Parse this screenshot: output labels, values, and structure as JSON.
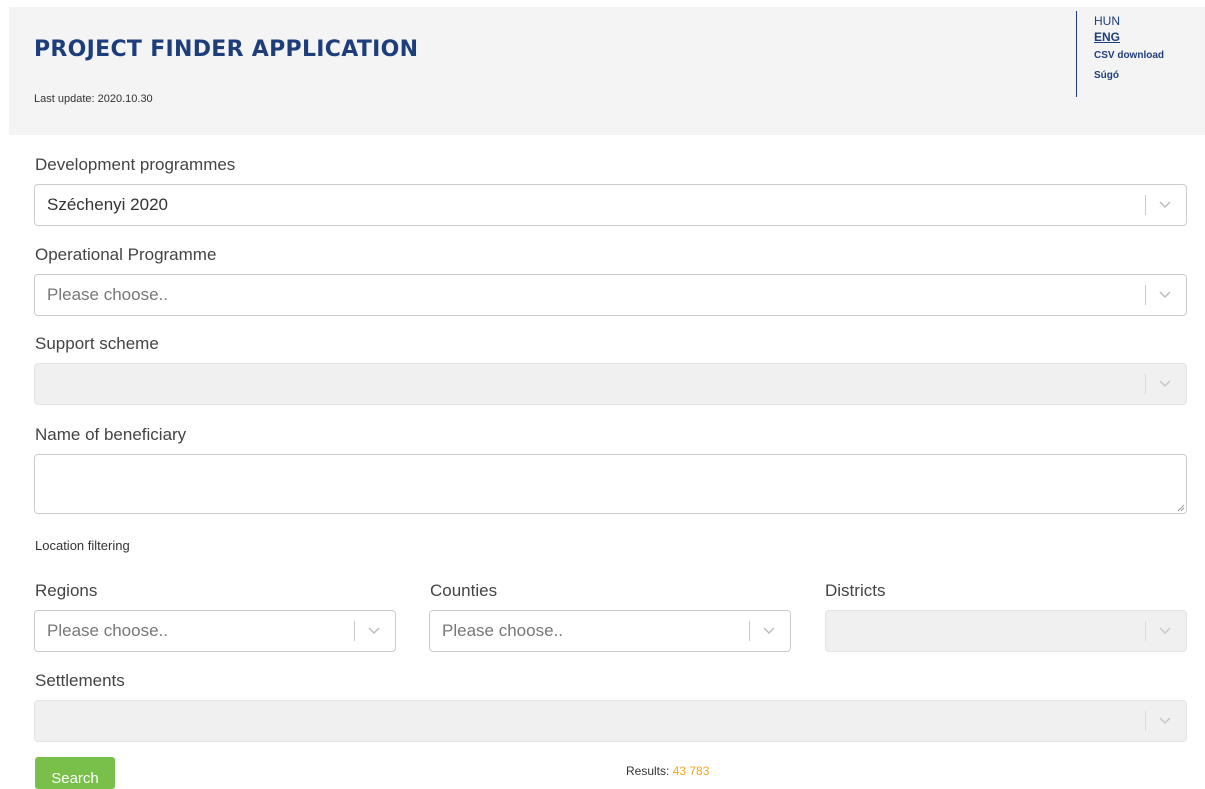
{
  "header": {
    "title": "PROJECT FINDER APPLICATION",
    "last_update_label": "Last update:",
    "last_update_value": "2020.10.30",
    "lang_hun": "HUN",
    "lang_eng": "ENG",
    "csv_download": "CSV download",
    "help": "Súgó"
  },
  "form": {
    "dev_programmes": {
      "label": "Development programmes",
      "value": "Széchenyi 2020"
    },
    "operational_programme": {
      "label": "Operational Programme",
      "placeholder": "Please choose.."
    },
    "support_scheme": {
      "label": "Support scheme",
      "value": ""
    },
    "beneficiary": {
      "label": "Name of beneficiary",
      "value": ""
    },
    "location_label": "Location filtering",
    "regions": {
      "label": "Regions",
      "placeholder": "Please choose.."
    },
    "counties": {
      "label": "Counties",
      "placeholder": "Please choose.."
    },
    "districts": {
      "label": "Districts",
      "value": ""
    },
    "settlements": {
      "label": "Settlements",
      "value": ""
    }
  },
  "actions": {
    "search_label": "Search",
    "results_label": "Results:",
    "results_count": "43 783"
  },
  "colors": {
    "brand": "#1e3e7b",
    "search_button": "#78c04a",
    "results_count": "#f5a623"
  }
}
